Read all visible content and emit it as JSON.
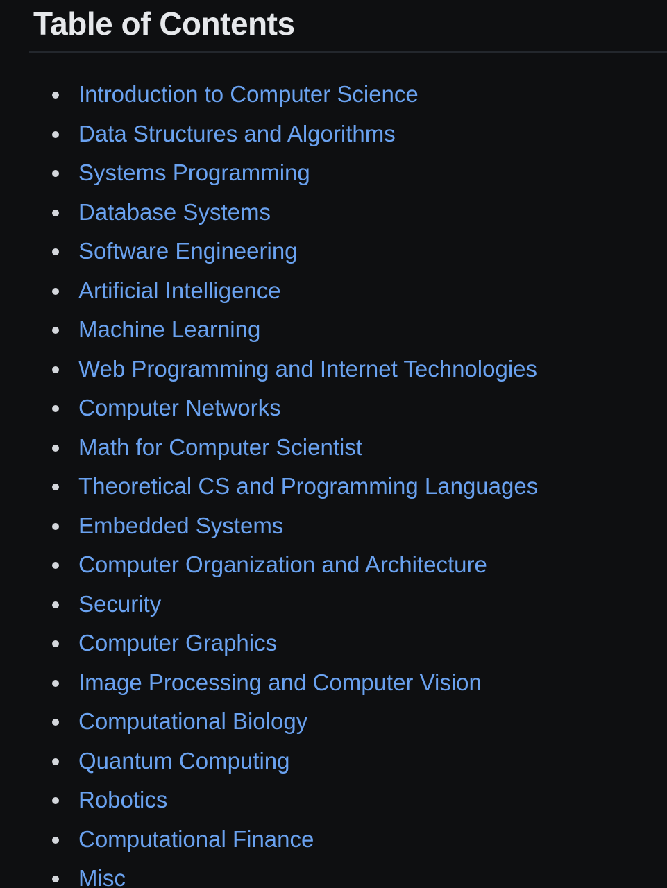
{
  "heading": "Table of Contents",
  "colors": {
    "background": "#0e0f11",
    "heading": "#e6e8eb",
    "link": "#6aa2f0",
    "bullet": "#d4d7dc",
    "divider": "#23272d"
  },
  "toc": {
    "items": [
      {
        "label": "Introduction to Computer Science"
      },
      {
        "label": "Data Structures and Algorithms"
      },
      {
        "label": "Systems Programming"
      },
      {
        "label": "Database Systems"
      },
      {
        "label": "Software Engineering"
      },
      {
        "label": "Artificial Intelligence"
      },
      {
        "label": "Machine Learning"
      },
      {
        "label": "Web Programming and Internet Technologies"
      },
      {
        "label": "Computer Networks"
      },
      {
        "label": "Math for Computer Scientist"
      },
      {
        "label": "Theoretical CS and Programming Languages"
      },
      {
        "label": "Embedded Systems"
      },
      {
        "label": "Computer Organization and Architecture"
      },
      {
        "label": "Security"
      },
      {
        "label": "Computer Graphics"
      },
      {
        "label": "Image Processing and Computer Vision"
      },
      {
        "label": "Computational Biology"
      },
      {
        "label": "Quantum Computing"
      },
      {
        "label": "Robotics"
      },
      {
        "label": "Computational Finance"
      },
      {
        "label": "Misc"
      }
    ]
  }
}
